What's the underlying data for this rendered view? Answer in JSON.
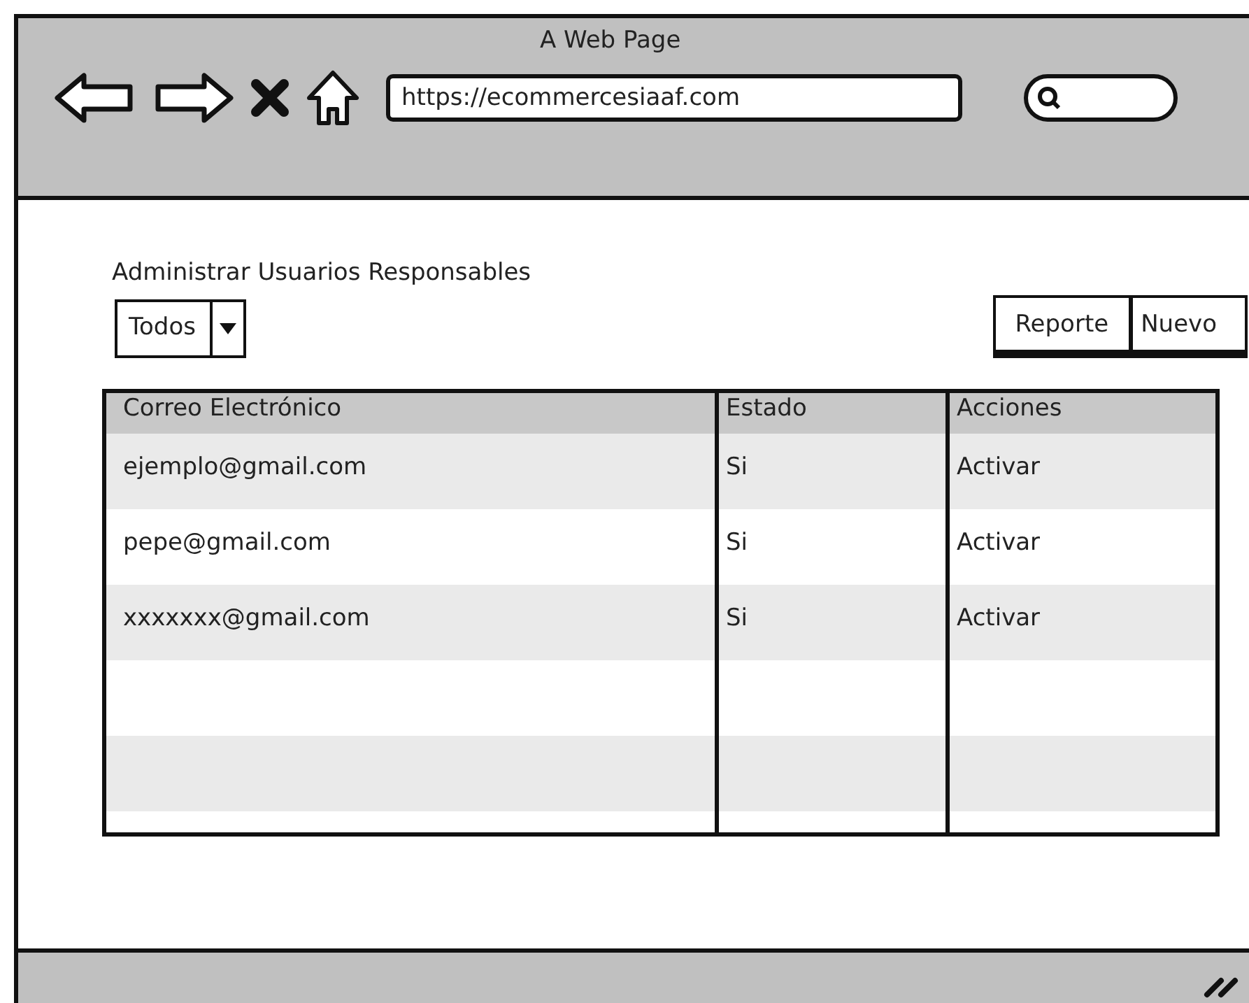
{
  "window": {
    "title": "A Web Page",
    "url": "https://ecommercesiaaf.com"
  },
  "heading": "Administrar Usuarios Responsables",
  "filter": {
    "value": "Todos"
  },
  "buttons": [
    {
      "label": "Reporte"
    },
    {
      "label": "Nuevo"
    }
  ],
  "table": {
    "columns": [
      "Correo Electrónico",
      "Estado",
      "Acciones"
    ],
    "rows": [
      [
        "ejemplo@gmail.com",
        "Si",
        "Activar"
      ],
      [
        "pepe@gmail.com",
        "Si",
        "Activar"
      ],
      [
        "xxxxxxx@gmail.com",
        "Si",
        "Activar"
      ]
    ]
  }
}
